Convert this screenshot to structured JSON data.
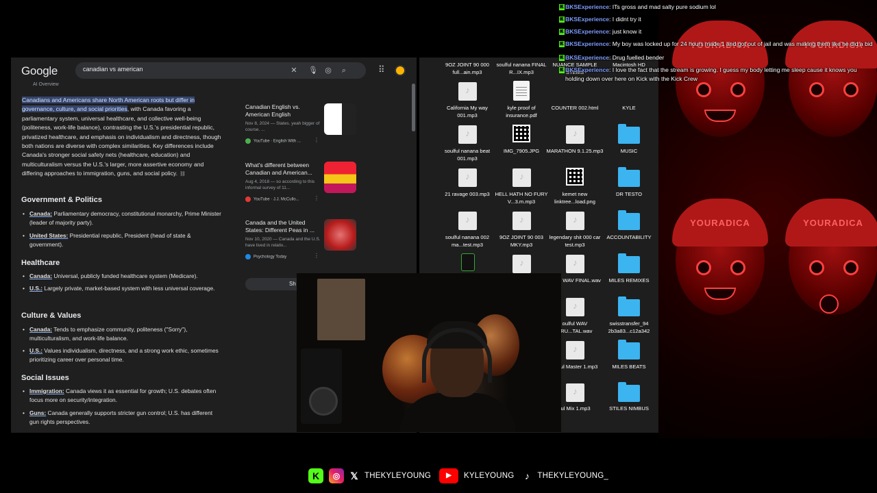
{
  "browser": {
    "logo": "Google",
    "query": "canadian vs american",
    "ai_label": "AI Overview",
    "ai_highlight": "Canadians and Americans share North American roots but differ in governance, culture, and social priorities",
    "ai_rest": ", with Canada favoring a parliamentary system, universal healthcare, and collective well-being (politeness, work-life balance), contrasting the U.S.'s presidential republic, privatized healthcare, and emphasis on individualism and directness, though both nations are diverse with complex similarities. Key differences include Canada's stronger social safety nets (healthcare, education) and multiculturalism versus the U.S.'s larger, more assertive economy and differing approaches to immigration, guns, and social policy.",
    "sections": [
      {
        "title": "Government & Politics"
      },
      {
        "title": "Healthcare"
      },
      {
        "title": "Culture & Values"
      },
      {
        "title": "Social Issues"
      }
    ],
    "bullets": {
      "gov_canada_term": "Canada:",
      "gov_canada_text": " Parliamentary democracy, constitutional monarchy, Prime Minister (leader of majority party).",
      "gov_us_term": "United States:",
      "gov_us_text": " Presidential republic, President (head of state & government).",
      "hc_canada_term": "Canada:",
      "hc_canada_text": " Universal, publicly funded healthcare system (Medicare).",
      "hc_us_term": "U.S.:",
      "hc_us_text": " Largely private, market-based system with less universal coverage.",
      "cv_canada_term": "Canada:",
      "cv_canada_text": " Tends to emphasize community, politeness (\"Sorry\"), multiculturalism, and work-life balance.",
      "cv_us_term": "U.S.:",
      "cv_us_text": " Values individualism, directness, and a strong work ethic, sometimes prioritizing career over personal time.",
      "si_imm_term": "Immigration:",
      "si_imm_text": " Canada views it as essential for growth; U.S. debates often focus more on security/integration.",
      "si_guns_term": "Guns:",
      "si_guns_text": " Canada generally supports stricter gun control; U.S. has different gun rights perspectives."
    },
    "cards": [
      {
        "title": "Canadian English vs. American English",
        "snippet": "Nov 8, 2024 — States. yeah bigger of course. ...",
        "source": "YouTube · English With ..."
      },
      {
        "title": "What's different between Canadian and American...",
        "snippet": "Aug 4, 2018 — so according to this informal survey of 11...",
        "source": "YouTube · J.J. McCullo..."
      },
      {
        "title": "Canada and the United States: Different Peas in ...",
        "snippet": "Nov 10, 2020 — Canada and the U.S. have lived in relativ...",
        "source": "Psychology Today"
      }
    ],
    "show_all": "Sh"
  },
  "desktop": {
    "items": [
      {
        "label": "9OZ JOINT 90 000 full...ain.mp3"
      },
      {
        "label": "soulful nanana FINAL R...IX.mp3"
      },
      {
        "label": "NUANCE SAMPLE STEMS"
      },
      {
        "label": "Macintosh HD"
      },
      {
        "label": "California My way 001.mp3"
      },
      {
        "label": "kyle proof of insurance.pdf"
      },
      {
        "label": "COUNTER 002.html"
      },
      {
        "label": "KYLE"
      },
      {
        "label": "soulful nanana beat 001.mp3"
      },
      {
        "label": "IMG_7905.JPG"
      },
      {
        "label": "MARATHON 9.1.25.mp3"
      },
      {
        "label": "MUSIC"
      },
      {
        "label": "21 ravage 003.mp3"
      },
      {
        "label": "HELL HATH NO FURY V...3.m.mp3"
      },
      {
        "label": "kemet new linktree...load.png"
      },
      {
        "label": "DR TESTO"
      },
      {
        "label": "soulful nanana 002 ma...test.mp3"
      },
      {
        "label": "9OZ JOINT 90 003 MKY.mp3"
      },
      {
        "label": "legendary shit 000 car test.mp3"
      },
      {
        "label": "ACCOUNTABILITY"
      },
      {
        "label": "oulful WAV FINAL.wav"
      },
      {
        "label": "MILES REMIXES"
      },
      {
        "label": "oulful WAV TRU...TAL.wav"
      },
      {
        "label": "swisstransfer_94 2b3a83...c12a342"
      },
      {
        "label": "oulful Master 1.mp3"
      },
      {
        "label": "MILES BEATS"
      },
      {
        "label": "ful Mix 1.mp3"
      },
      {
        "label": "STILES NIMBUS"
      }
    ]
  },
  "chat": {
    "messages": [
      {
        "user": "BKSExperience",
        "text": " ITs gross and mad salty pure sodium lol"
      },
      {
        "user": "BKSExperience",
        "text": " I didnt try it"
      },
      {
        "user": "BKSExperience",
        "text": " just know it"
      },
      {
        "user": "BKSExperience",
        "text": " My boy was locked up for 24 hours made 1 and got out of jail and was making them like he did a bid"
      },
      {
        "user": "BKSExperience",
        "text": " Drug fuelled bender"
      },
      {
        "user": "BKSExperience",
        "text": " I love the fact that the stream is growing. I guess my body letting me sleep cause it knows you holding down over here on Kick with the Kick Crew"
      }
    ]
  },
  "overlay": {
    "cap_text": "YOURADICA"
  },
  "social": {
    "x_handle": "THEKYLEYOUNG",
    "youtube_handle": "KYLEYOUNG",
    "tiktok_handle": "THEKYLEYOUNG_"
  },
  "colors": {
    "kick_green": "#53fc18",
    "chat_user": "#7e9bff",
    "ai_highlight_bg": "#36456d"
  }
}
